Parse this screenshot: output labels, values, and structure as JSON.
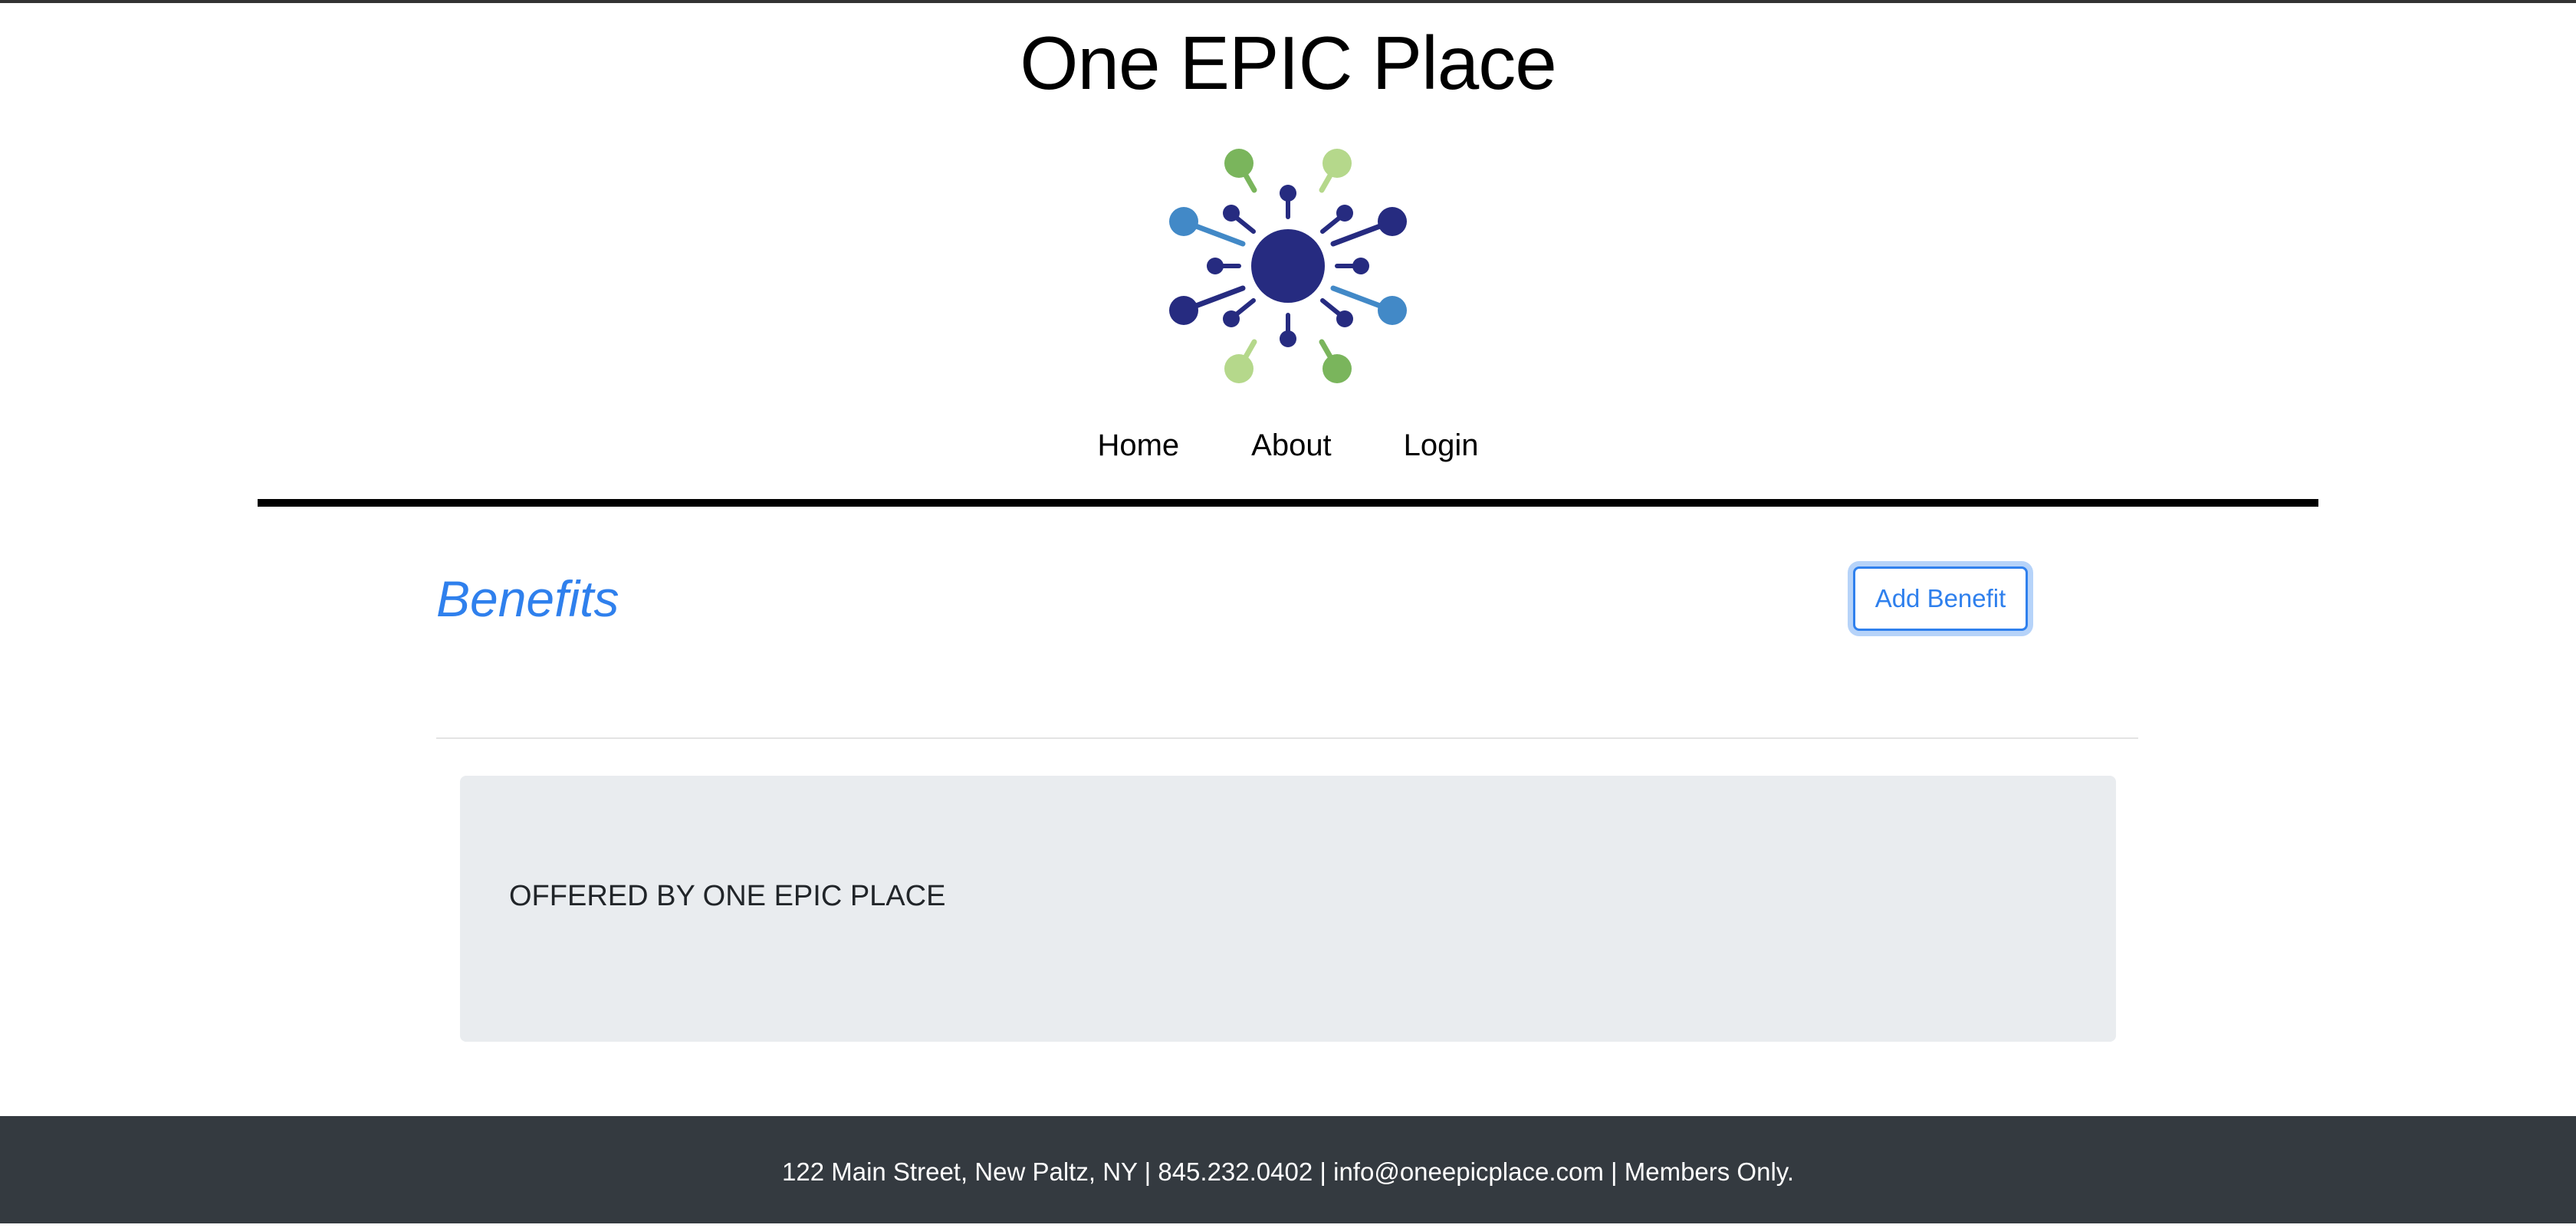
{
  "header": {
    "site_title": "One EPIC Place"
  },
  "logo": {
    "icon": "network-hub-logo-icon",
    "colors": {
      "navy": "#262b80",
      "green": "#7ab55c",
      "light_green": "#b5d88b",
      "blue": "#4289c7"
    }
  },
  "nav": {
    "items": [
      {
        "label": "Home"
      },
      {
        "label": "About"
      },
      {
        "label": "Login"
      }
    ]
  },
  "main": {
    "heading": "Benefits",
    "add_button_label": "Add Benefit",
    "benefits": [
      {
        "label": "OFFERED BY ONE EPIC PLACE"
      }
    ]
  },
  "footer": {
    "text": "122 Main Street, New Paltz, NY | 845.232.0402 | info@oneepicplace.com | Members Only."
  },
  "theme": {
    "accent": "#2f80ed",
    "card_background": "#e9ecef",
    "footer_background": "#343a40"
  }
}
